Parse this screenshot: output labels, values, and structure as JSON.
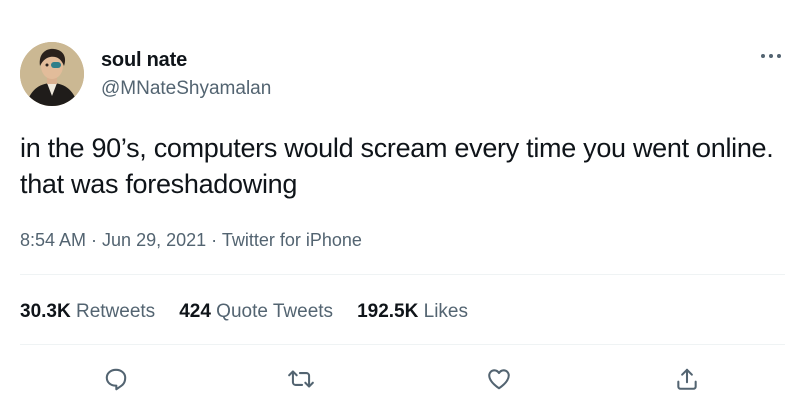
{
  "author": {
    "display_name": "soul nate",
    "handle": "@MNateShyamalan",
    "avatar_icon": "avatar-portrait"
  },
  "tweet": {
    "text": "in the 90’s, computers would scream every time you went online. that was foreshadowing"
  },
  "meta": {
    "time": "8:54 AM",
    "sep1": " · ",
    "date": "Jun 29, 2021",
    "sep2": " · ",
    "source": "Twitter for iPhone"
  },
  "stats": {
    "retweets": {
      "count": "30.3K",
      "label": "Retweets"
    },
    "quotes": {
      "count": "424",
      "label": "Quote Tweets"
    },
    "likes": {
      "count": "192.5K",
      "label": "Likes"
    }
  },
  "actions": [
    "reply-icon",
    "retweet-icon",
    "like-icon",
    "share-icon"
  ],
  "colors": {
    "text": "#0f1419",
    "secondary": "#536471",
    "divider": "#eff3f4"
  }
}
